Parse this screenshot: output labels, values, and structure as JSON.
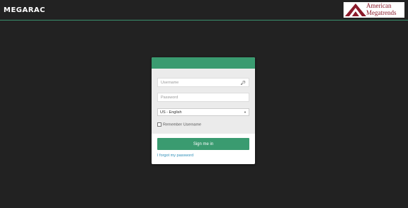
{
  "header": {
    "brand": "MEGARAC",
    "logo_line1": "American",
    "logo_line2": "Megatrends"
  },
  "login": {
    "username_placeholder": "Username",
    "password_placeholder": "Password",
    "language_selected": "US - English",
    "remember_label": "Remember Username",
    "signin_label": "Sign me in",
    "forgot_label": "I forgot my password"
  },
  "colors": {
    "accent": "#3a9b70",
    "logo": "#8b1a2a",
    "link": "#2e8fb8"
  },
  "icons": {
    "username_field_icon": "key-icon"
  }
}
